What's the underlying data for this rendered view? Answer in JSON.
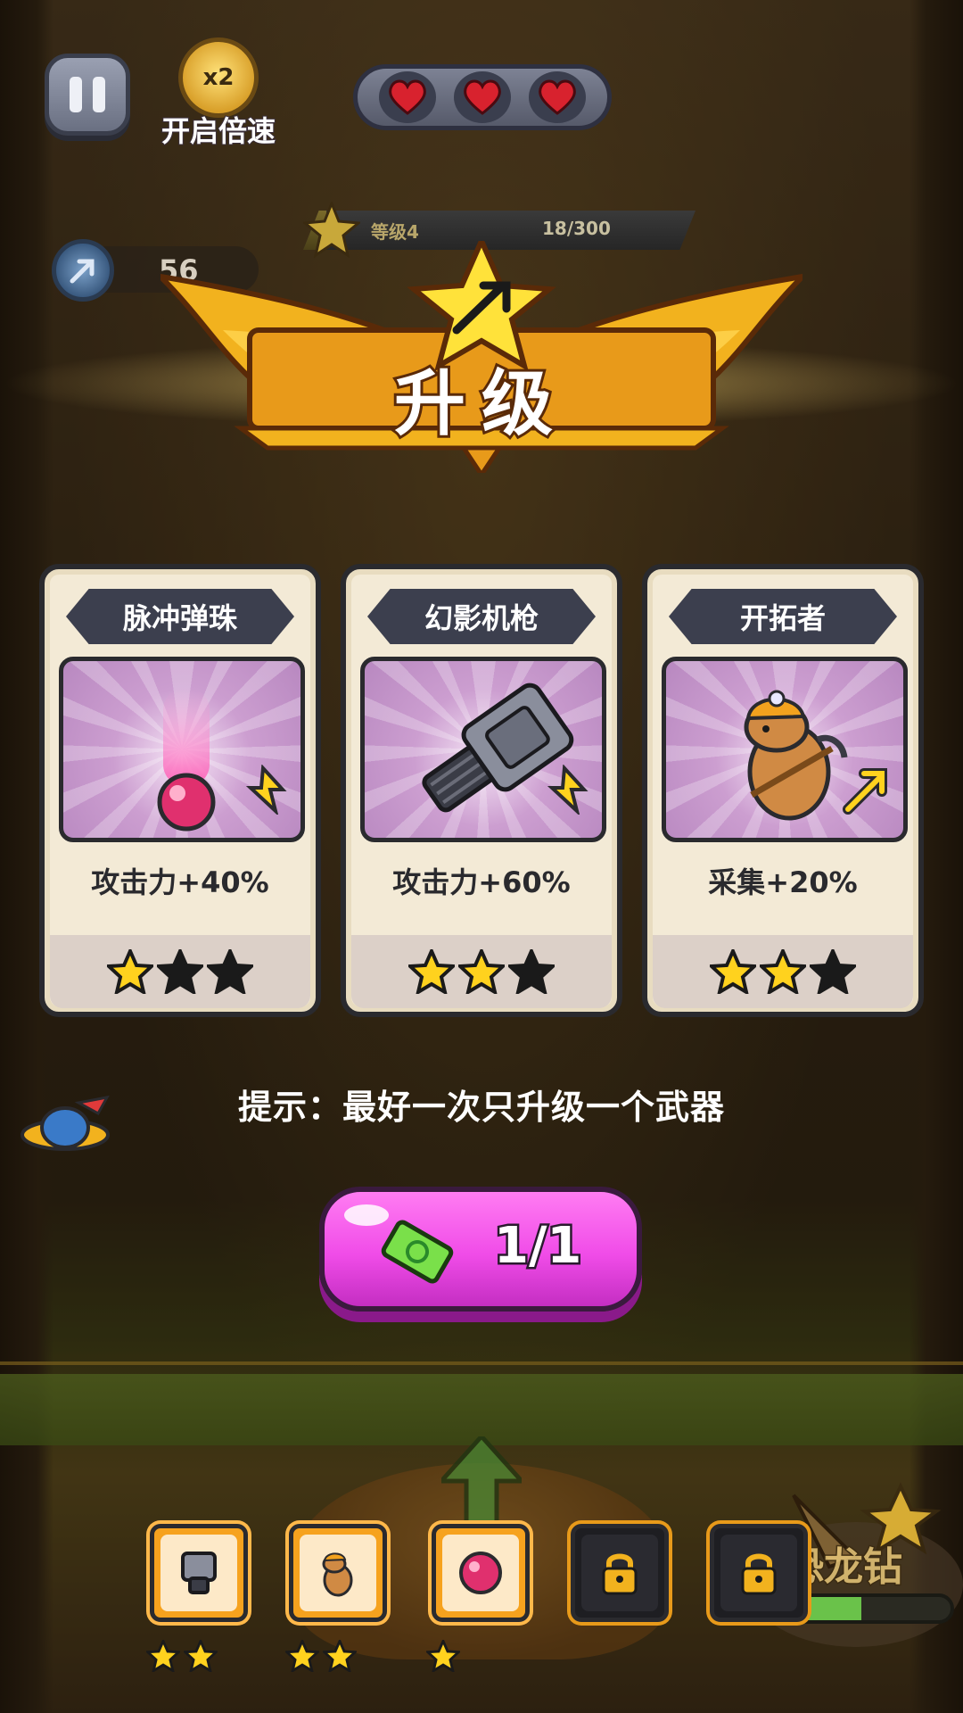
{
  "hud": {
    "speed_badge": "x2",
    "speed_label": "开启倍速",
    "lives": 3,
    "level_label": "等级4",
    "level_progress_text": "18/300",
    "level_progress": 0.06,
    "depth_value": "56"
  },
  "banner": {
    "title": "升级"
  },
  "cards": [
    {
      "name": "脉冲弹珠",
      "effect": "攻击力+40%",
      "stars_filled": 1,
      "stars_total": 3,
      "icon": "pink-orb-icon"
    },
    {
      "name": "幻影机枪",
      "effect": "攻击力+60%",
      "stars_filled": 2,
      "stars_total": 3,
      "icon": "gatling-gun-icon"
    },
    {
      "name": "开拓者",
      "effect": "采集+20%",
      "stars_filled": 2,
      "stars_total": 3,
      "icon": "miner-capybara-icon"
    }
  ],
  "tip": "提示：最好一次只升级一个武器",
  "refresh_button": {
    "count": "1/1",
    "icon": "ticket-icon"
  },
  "slots": [
    {
      "icon": "gatling-gun-icon",
      "stars": 2,
      "locked": false
    },
    {
      "icon": "miner-capybara-icon",
      "stars": 2,
      "locked": false
    },
    {
      "icon": "pink-orb-icon",
      "stars": 1,
      "locked": false
    },
    {
      "icon": "lock-icon",
      "stars": 0,
      "locked": true
    },
    {
      "icon": "lock-icon",
      "stars": 0,
      "locked": true
    }
  ],
  "drill": {
    "label": "恐龙钻",
    "progress": 0.55
  },
  "colors": {
    "card_bg": "#f3ead6",
    "plate": "#3c3f4e",
    "button_pink": "#f04ce8",
    "slot_orange": "#f6a21e",
    "star_gold": "#ffd21e"
  }
}
